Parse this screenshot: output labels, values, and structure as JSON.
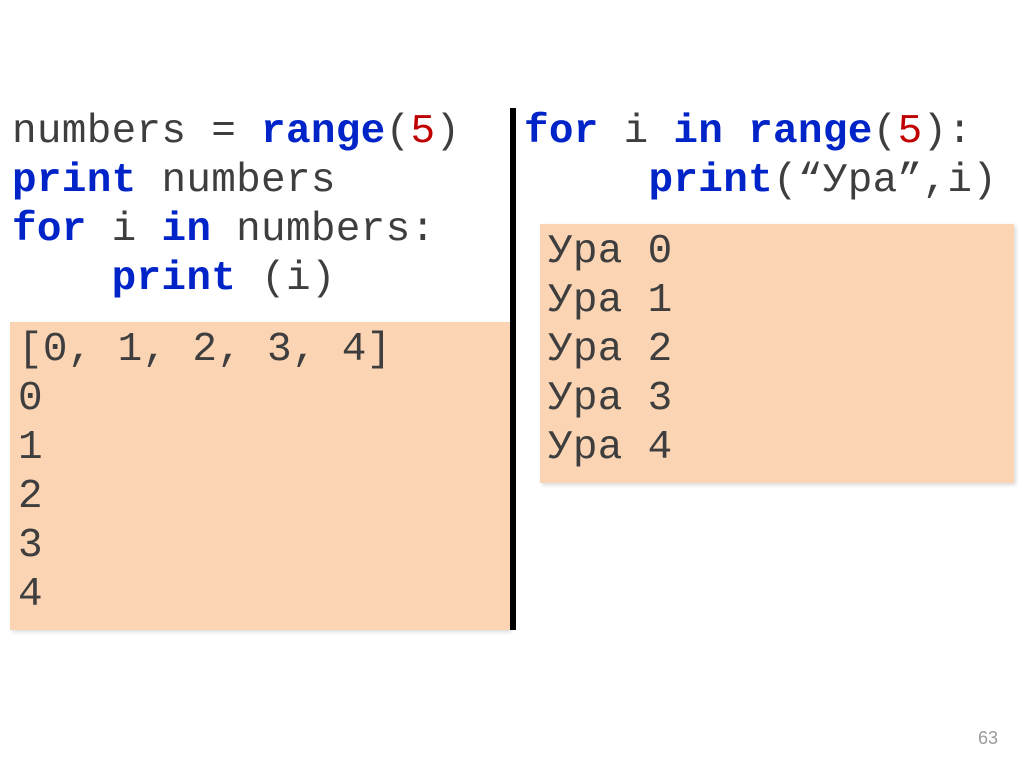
{
  "left": {
    "code": {
      "l1": {
        "a": "numbers = ",
        "b": "range",
        "c": "(",
        "d": "5",
        "e": ")"
      },
      "l2": {
        "a": "print ",
        "b": "numbers"
      },
      "l3": {
        "a": "for ",
        "b": "i ",
        "c": "in ",
        "d": "numbers:"
      },
      "l4": {
        "a": "    ",
        "b": "print ",
        "c": "(i)"
      }
    },
    "output": "[0, 1, 2, 3, 4]\n0\n1\n2\n3\n4"
  },
  "right": {
    "code": {
      "l1": {
        "a": "for ",
        "b": "i ",
        "c": "in ",
        "d": "range",
        "e": "(",
        "f": "5",
        "g": "):"
      },
      "l2": {
        "a": "     ",
        "b": "print",
        "c": "(“Ура”,i)"
      }
    },
    "output": "Ура 0\nУра 1\nУра 2\nУра 3\nУра 4"
  },
  "page_number": "63"
}
